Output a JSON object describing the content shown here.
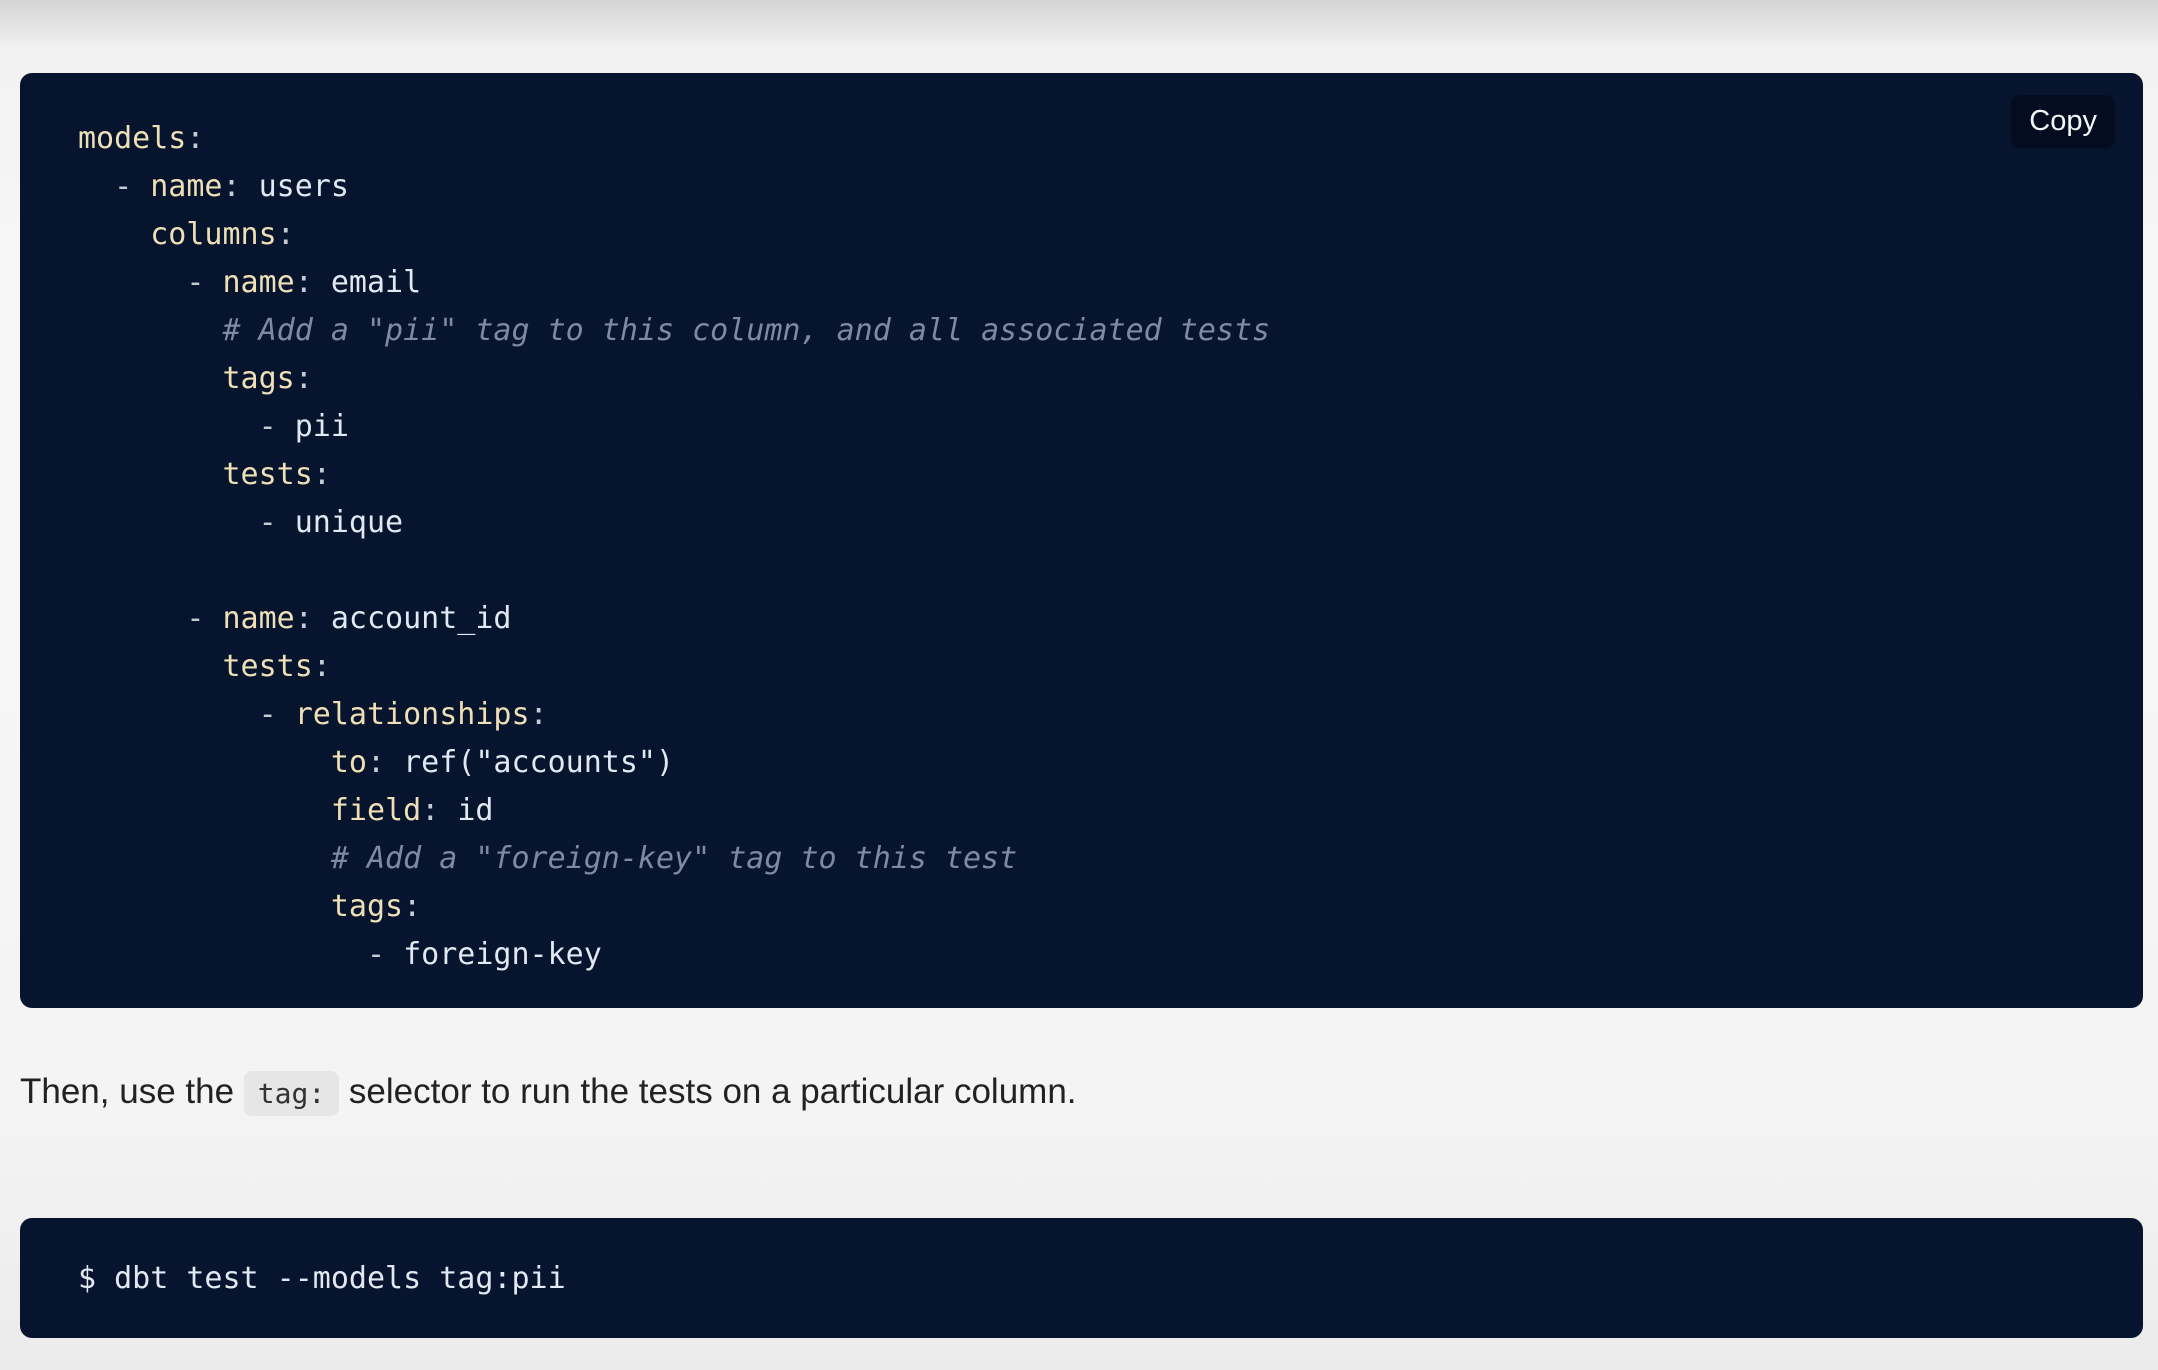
{
  "code_block": {
    "copy_label": "Copy",
    "lines": [
      [
        {
          "t": "models",
          "c": "k"
        },
        {
          "t": ":",
          "c": "p"
        }
      ],
      [
        {
          "t": "  - ",
          "c": "p"
        },
        {
          "t": "name",
          "c": "k"
        },
        {
          "t": ": ",
          "c": "p"
        },
        {
          "t": "users",
          "c": "v"
        }
      ],
      [
        {
          "t": "    ",
          "c": "p"
        },
        {
          "t": "columns",
          "c": "k"
        },
        {
          "t": ":",
          "c": "p"
        }
      ],
      [
        {
          "t": "      - ",
          "c": "p"
        },
        {
          "t": "name",
          "c": "k"
        },
        {
          "t": ": ",
          "c": "p"
        },
        {
          "t": "email",
          "c": "v"
        }
      ],
      [
        {
          "t": "        ",
          "c": "p"
        },
        {
          "t": "# Add a \"pii\" tag to this column, and all associated tests",
          "c": "c"
        }
      ],
      [
        {
          "t": "        ",
          "c": "p"
        },
        {
          "t": "tags",
          "c": "k"
        },
        {
          "t": ":",
          "c": "p"
        }
      ],
      [
        {
          "t": "          - ",
          "c": "p"
        },
        {
          "t": "pii",
          "c": "v"
        }
      ],
      [
        {
          "t": "        ",
          "c": "p"
        },
        {
          "t": "tests",
          "c": "k"
        },
        {
          "t": ":",
          "c": "p"
        }
      ],
      [
        {
          "t": "          - ",
          "c": "p"
        },
        {
          "t": "unique",
          "c": "v"
        }
      ],
      [],
      [
        {
          "t": "      - ",
          "c": "p"
        },
        {
          "t": "name",
          "c": "k"
        },
        {
          "t": ": ",
          "c": "p"
        },
        {
          "t": "account_id",
          "c": "v"
        }
      ],
      [
        {
          "t": "        ",
          "c": "p"
        },
        {
          "t": "tests",
          "c": "k"
        },
        {
          "t": ":",
          "c": "p"
        }
      ],
      [
        {
          "t": "          - ",
          "c": "p"
        },
        {
          "t": "relationships",
          "c": "k"
        },
        {
          "t": ":",
          "c": "p"
        }
      ],
      [
        {
          "t": "              ",
          "c": "p"
        },
        {
          "t": "to",
          "c": "k"
        },
        {
          "t": ": ",
          "c": "p"
        },
        {
          "t": "ref(\"accounts\")",
          "c": "v"
        }
      ],
      [
        {
          "t": "              ",
          "c": "p"
        },
        {
          "t": "field",
          "c": "k"
        },
        {
          "t": ": ",
          "c": "p"
        },
        {
          "t": "id",
          "c": "v"
        }
      ],
      [
        {
          "t": "              ",
          "c": "p"
        },
        {
          "t": "# Add a \"foreign-key\" tag to this test",
          "c": "c"
        }
      ],
      [
        {
          "t": "              ",
          "c": "p"
        },
        {
          "t": "tags",
          "c": "k"
        },
        {
          "t": ":",
          "c": "p"
        }
      ],
      [
        {
          "t": "                - ",
          "c": "p"
        },
        {
          "t": "foreign-key",
          "c": "v"
        }
      ]
    ]
  },
  "paragraph": {
    "before": "Then, use the ",
    "inline_code": "tag:",
    "after": " selector to run the tests on a particular column."
  },
  "shell_block": {
    "command": "$ dbt test --models tag:pii"
  }
}
